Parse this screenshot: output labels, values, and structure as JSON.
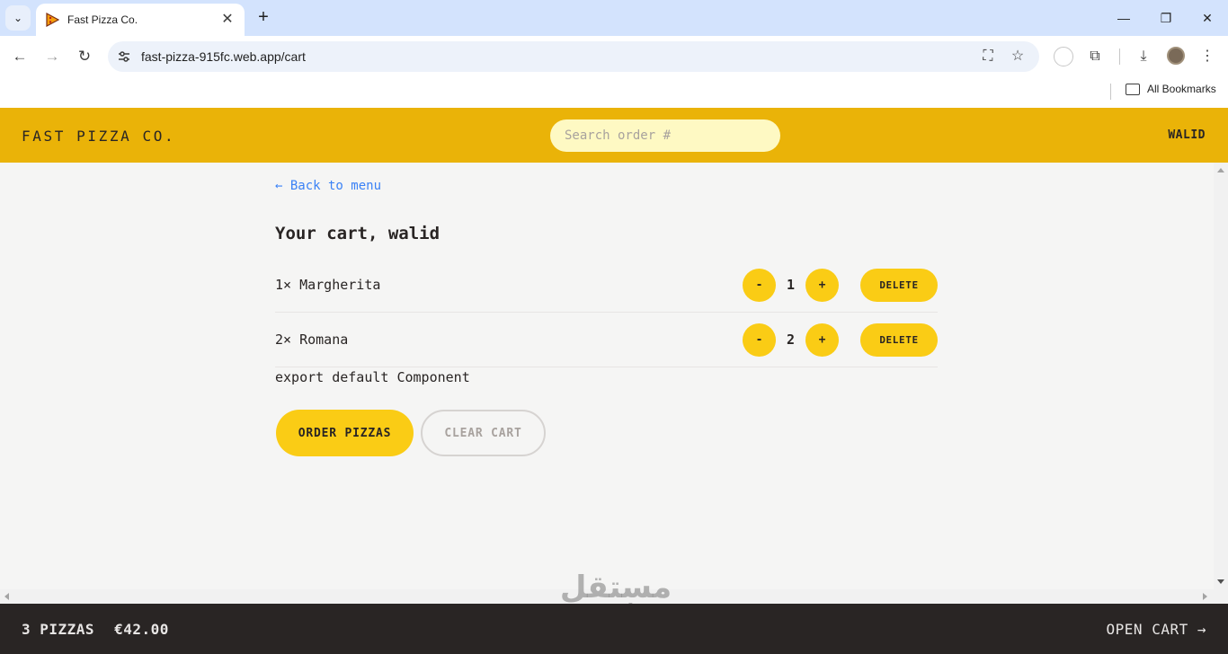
{
  "browser": {
    "tab_title": "Fast Pizza Co.",
    "url": "fast-pizza-915fc.web.app/cart",
    "bookmarks_label": "All Bookmarks",
    "icons": {
      "tab_search": "chevron-down-icon",
      "favicon": "pizza-slice-icon",
      "close": "close-icon",
      "new_tab": "plus-icon",
      "back": "arrow-left-icon",
      "forward": "arrow-right-icon",
      "reload": "reload-icon",
      "site_info": "tune-icon",
      "translate": "translate-icon",
      "star": "star-icon",
      "extensions": "puzzle-icon",
      "download": "download-icon",
      "menu": "kebab-menu-icon"
    },
    "glyphs": {
      "tab_search": "⌄",
      "close": "✕",
      "new_tab": "+",
      "minimize": "—",
      "restore": "❐",
      "win_close": "✕",
      "back": "←",
      "forward": "→",
      "reload": "↻",
      "translate": "⛶",
      "star": "☆",
      "extensions": "⧉",
      "download": "⤓",
      "menu": "⋮"
    }
  },
  "header": {
    "brand": "FAST PIZZA CO.",
    "search_placeholder": "Search order #",
    "username": "WALID",
    "color": "#eab308"
  },
  "cart": {
    "back_link": "← Back to menu",
    "title": "Your cart, walid",
    "items": [
      {
        "name": "1× Margherita",
        "quantity": "1",
        "decrease": "-",
        "increase": "+",
        "delete": "DELETE"
      },
      {
        "name": "2× Romana",
        "quantity": "2",
        "decrease": "-",
        "increase": "+",
        "delete": "DELETE"
      }
    ],
    "code_text": "export default Component",
    "order_button": "ORDER PIZZAS",
    "clear_button": "CLEAR CART",
    "accent_color": "#facc15"
  },
  "watermark": {
    "arabic": "مستقل",
    "latin": "mostaql.com"
  },
  "footer": {
    "pizza_count": "3 PIZZAS",
    "total": "€42.00",
    "open_cart": "OPEN CART →",
    "background": "#292524"
  }
}
